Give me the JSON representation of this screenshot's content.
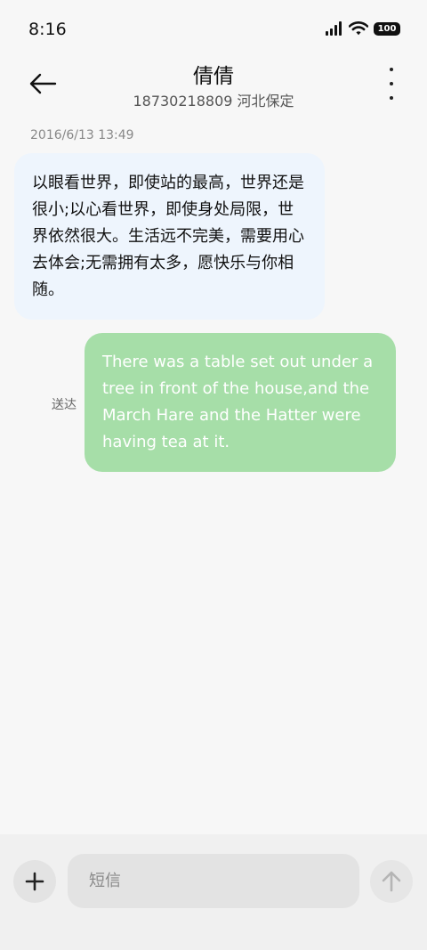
{
  "status_bar": {
    "time": "8:16",
    "battery": "100"
  },
  "header": {
    "contact_name": "倩倩",
    "contact_detail": "18730218809 河北保定"
  },
  "messages": {
    "timestamp": "2016/6/13 13:49",
    "incoming_text": "以眼看世界，即使站的最高，世界还是很小;以心看世界，即使身处局限，世界依然很大。生活远不完美，需要用心去体会;无需拥有太多，愿快乐与你相随。",
    "outgoing_text": "There was a table set out under a tree in front of the house,and the March Hare and the Hatter were having tea at it.",
    "outgoing_status": "送达"
  },
  "composer": {
    "placeholder": "短信",
    "value": ""
  },
  "colors": {
    "incoming_bubble": "#eef5fd",
    "outgoing_bubble": "#a6dea8"
  },
  "icons": {
    "back": "arrow-left-icon",
    "more": "more-vertical-icon",
    "add": "plus-icon",
    "send": "arrow-up-icon",
    "signal": "signal-icon",
    "wifi": "wifi-icon",
    "battery": "battery-icon"
  }
}
